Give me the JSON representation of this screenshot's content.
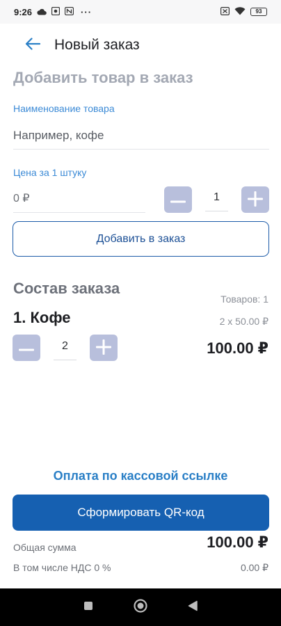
{
  "status_bar": {
    "time": "9:26",
    "ellipsis": "···",
    "battery": "93",
    "icons": [
      "cloud-icon",
      "settings-box-icon",
      "nfc-icon",
      "sim-off-icon",
      "wifi-icon",
      "battery-icon"
    ]
  },
  "app_bar": {
    "title": "Новый заказ",
    "back_icon": "arrow-left-icon"
  },
  "add_section": {
    "heading": "Добавить товар в заказ",
    "name_label": "Наименование товара",
    "name_placeholder": "Например, кофе",
    "price_label": "Цена за 1 штуку",
    "price_placeholder": "0 ₽",
    "quantity": "1",
    "add_button": "Добавить в заказ"
  },
  "order_section": {
    "heading": "Состав заказа",
    "items_count": "Товаров: 1",
    "items": [
      {
        "title": "1. Кофе",
        "quantity": "2",
        "unit_price": "2 x 50.00 ₽",
        "total": "100.00 ₽"
      }
    ]
  },
  "payment": {
    "link_label": "Оплата по кассовой ссылке",
    "qr_button": "Сформировать QR-код",
    "total_label": "Общая сумма",
    "total_value": "100.00 ₽",
    "vat_label": "В том числе НДС 0 %",
    "vat_value": "0.00 ₽"
  },
  "colors": {
    "accent": "#1660b1",
    "label_blue": "#3b8ad6",
    "stepper": "#b8bfdc"
  },
  "nav_bar": {
    "icons": [
      "recents-square-icon",
      "home-circle-icon",
      "back-triangle-icon"
    ]
  }
}
